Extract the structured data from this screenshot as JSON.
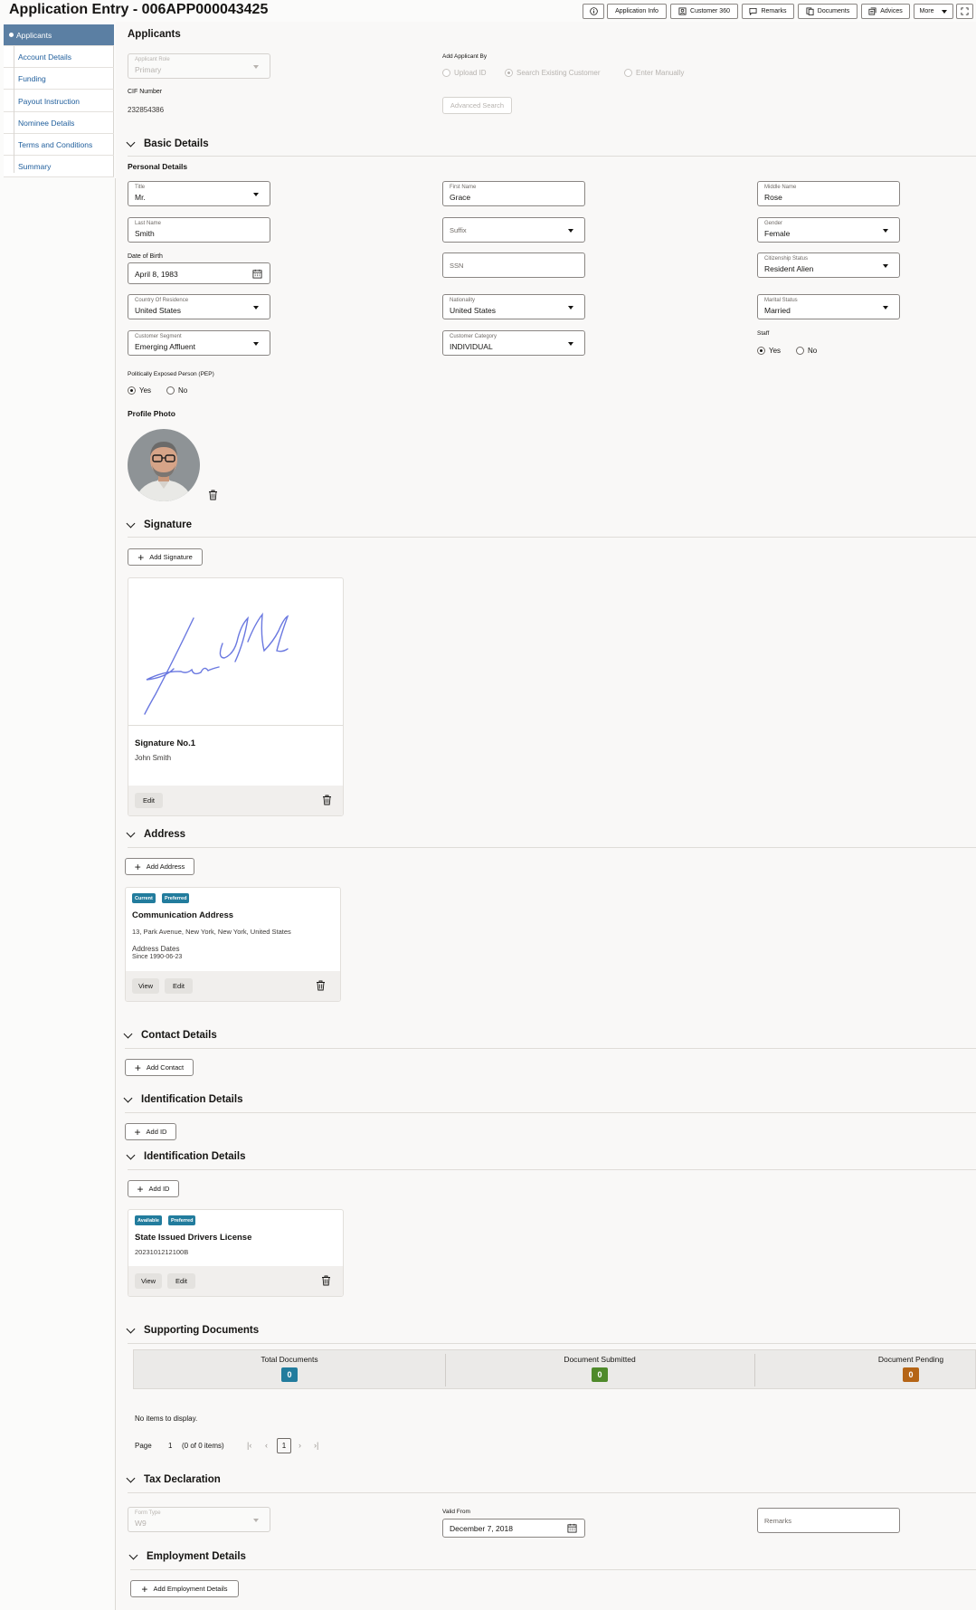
{
  "header": {
    "title": "Application Entry - 006APP000043425",
    "toolbar": {
      "application_info": "Application Info",
      "customer_360": "Customer 360",
      "remarks": "Remarks",
      "documents": "Documents",
      "advices": "Advices",
      "more": "More"
    }
  },
  "sidebar": {
    "items": [
      {
        "label": "Applicants",
        "active": true
      },
      {
        "label": "Account Details"
      },
      {
        "label": "Funding"
      },
      {
        "label": "Payout Instruction"
      },
      {
        "label": "Nominee Details"
      },
      {
        "label": "Terms and Conditions"
      },
      {
        "label": "Summary"
      }
    ]
  },
  "applicants": {
    "title": "Applicants",
    "role_label": "Applicant Role",
    "role_value": "Primary",
    "add_by_label": "Add Applicant By",
    "add_by_options": [
      "Upload ID",
      "Search Existing Customer",
      "Enter Manually"
    ],
    "add_by_selected": "Search Existing Customer",
    "cif_label": "CIF Number",
    "cif_value": "232854386",
    "advanced_search": "Advanced Search"
  },
  "basic": {
    "title": "Basic Details",
    "personal_title": "Personal Details",
    "title_field": {
      "label": "Title",
      "value": "Mr."
    },
    "first_name": {
      "label": "First Name",
      "value": "Grace"
    },
    "middle_name": {
      "label": "Middle Name",
      "value": "Rose"
    },
    "last_name": {
      "label": "Last Name",
      "value": "Smith"
    },
    "suffix": {
      "placeholder": "Suffix"
    },
    "gender": {
      "label": "Gender",
      "value": "Female"
    },
    "dob": {
      "label": "Date of Birth",
      "value": "April 8, 1983"
    },
    "ssn": {
      "placeholder": "SSN"
    },
    "citizenship": {
      "label": "Citizenship Status",
      "value": "Resident Alien"
    },
    "country": {
      "label": "Country Of Residence",
      "value": "United States"
    },
    "nationality": {
      "label": "Nationality",
      "value": "United States"
    },
    "marital": {
      "label": "Marital Status",
      "value": "Married"
    },
    "segment": {
      "label": "Customer Segment",
      "value": "Emerging Affluent"
    },
    "category": {
      "label": "Customer Category",
      "value": "INDIVIDUAL"
    },
    "staff": {
      "label": "Staff",
      "yes": "Yes",
      "no": "No",
      "selected": "Yes"
    },
    "pep": {
      "label": "Politically Exposed Person (PEP)",
      "yes": "Yes",
      "no": "No",
      "selected": "Yes"
    },
    "photo_title": "Profile Photo"
  },
  "signature": {
    "title": "Signature",
    "add_label": "Add Signature",
    "card_title": "Signature No.1",
    "card_name": "John Smith",
    "edit_label": "Edit"
  },
  "address": {
    "title": "Address",
    "add_label": "Add Address",
    "badges": [
      "Current",
      "Preferred"
    ],
    "card_title": "Communication Address",
    "line": "13, Park Avenue, New York, New York, United States",
    "dates_label": "Address Dates",
    "since": "Since 1990-06-23",
    "view_label": "View",
    "edit_label": "Edit"
  },
  "contact": {
    "title": "Contact Details",
    "add_label": "Add Contact"
  },
  "identification": {
    "title": "Identification Details",
    "add_label": "Add ID"
  },
  "identification2": {
    "title": "Identification Details",
    "add_label": "Add ID",
    "badges": [
      "Available",
      "Preferred"
    ],
    "card_title": "State Issued Drivers License",
    "card_number": "2023101212100B",
    "view_label": "View",
    "edit_label": "Edit"
  },
  "supporting": {
    "title": "Supporting Documents",
    "total_label": "Total Documents",
    "total_value": "0",
    "submitted_label": "Document Submitted",
    "submitted_value": "0",
    "pending_label": "Document Pending",
    "pending_value": "0",
    "no_items": "No items to display.",
    "page_label": "Page",
    "page_value": "1",
    "items_info": "(0 of 0 items)",
    "current_page": "1"
  },
  "tax": {
    "title": "Tax Declaration",
    "form_type": {
      "label": "Form Type",
      "value": "W9"
    },
    "valid_from": {
      "label": "Valid From",
      "value": "December 7, 2018"
    },
    "remarks": {
      "placeholder": "Remarks"
    }
  },
  "employment": {
    "title": "Employment Details",
    "add_label": "Add Employment Details"
  },
  "colors": {
    "accent": "#227c9d",
    "sidebar_active": "#5b7fa3",
    "link": "#1f5e9c",
    "submitted": "#4f8a2b",
    "pending": "#b56516"
  }
}
